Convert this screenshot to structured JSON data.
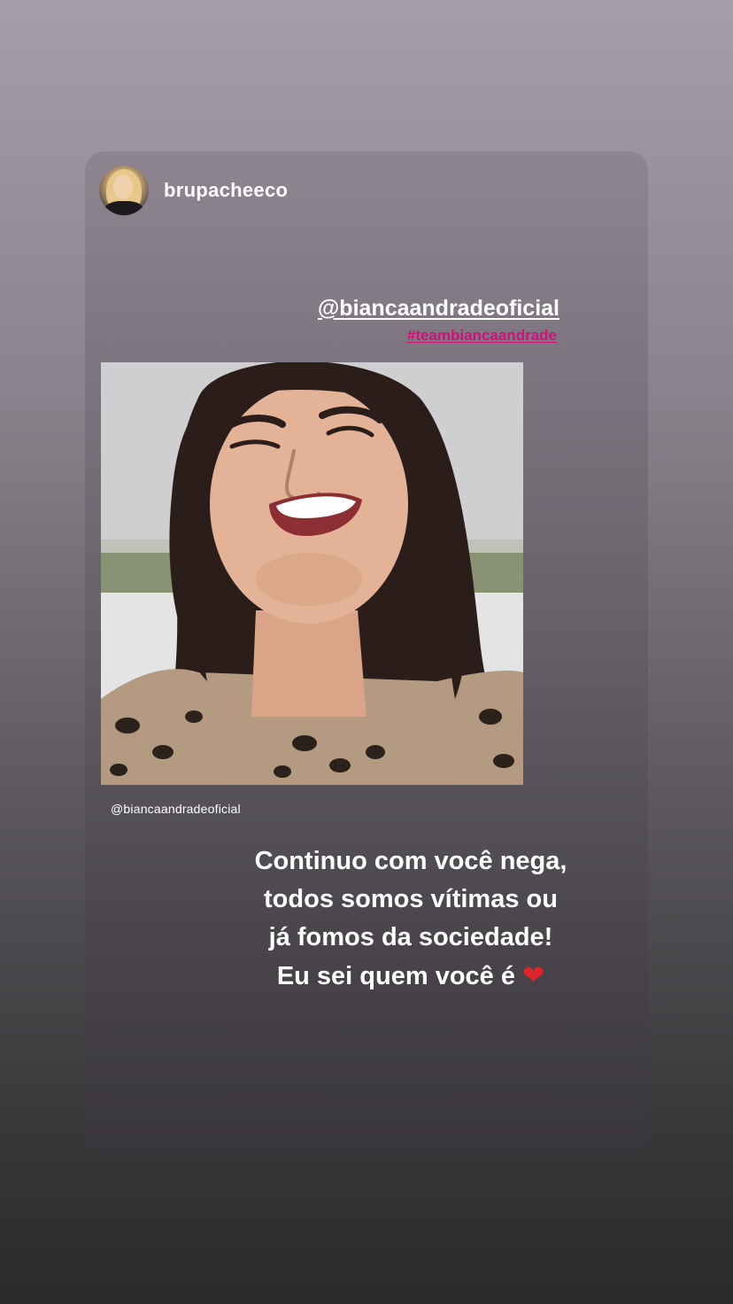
{
  "story": {
    "username": "brupacheeco",
    "mention": "@biancaandradeoficial",
    "hashtag": "#teambiancaandrade",
    "photo_credit": "@biancaandradeoficial",
    "caption_lines": [
      "Continuo com você nega,",
      "todos somos vítimas ou",
      "já fomos da sociedade!",
      "Eu sei quem você é"
    ],
    "heart_glyph": "❤"
  },
  "colors": {
    "hashtag": "#d0107c",
    "heart": "#e0242a",
    "text": "#ffffff"
  },
  "icons": {
    "avatar": "user-avatar-photo",
    "heart": "red-heart-emoji"
  }
}
